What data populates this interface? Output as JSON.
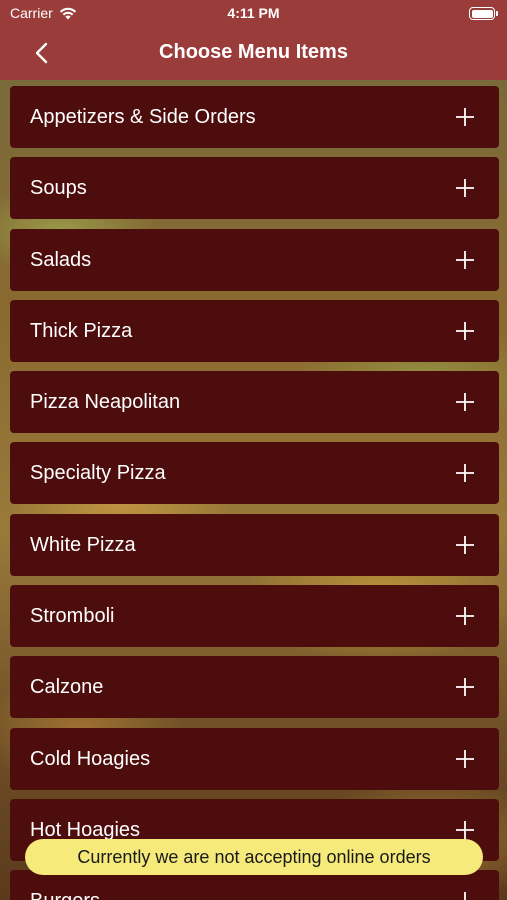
{
  "status": {
    "carrier": "Carrier",
    "time": "4:11 PM"
  },
  "navbar": {
    "title": "Choose Menu Items"
  },
  "menu": [
    {
      "label": "Appetizers & Side Orders"
    },
    {
      "label": "Soups"
    },
    {
      "label": "Salads"
    },
    {
      "label": "Thick Pizza"
    },
    {
      "label": "Pizza Neapolitan"
    },
    {
      "label": "Specialty Pizza"
    },
    {
      "label": "White Pizza"
    },
    {
      "label": "Stromboli"
    },
    {
      "label": "Calzone"
    },
    {
      "label": "Cold Hoagies"
    },
    {
      "label": "Hot Hoagies"
    },
    {
      "label": "Burgers"
    }
  ],
  "toast": {
    "text": "Currently we are not accepting online orders"
  },
  "colors": {
    "header": "#9a3c3a",
    "item_bg": "#4e0d0d",
    "toast_bg": "#f5ea7a"
  }
}
